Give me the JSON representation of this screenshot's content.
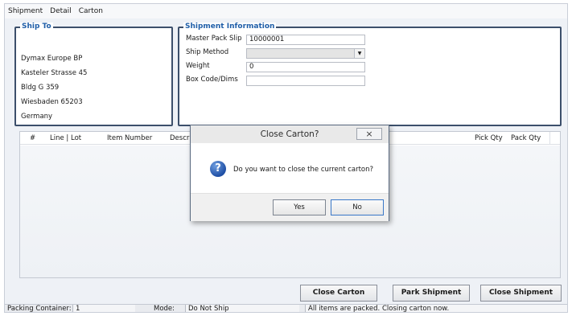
{
  "menu": [
    "Shipment",
    "Detail",
    "Carton"
  ],
  "ship_to": {
    "title": "Ship To",
    "lines": [
      "Dymax Europe BP",
      "Kasteler Strasse 45",
      "Bldg G 359",
      "Wiesbaden  65203",
      "Germany"
    ]
  },
  "shipment_info": {
    "title": "Shipment Information",
    "master_pack_slip_label": "Master Pack Slip",
    "master_pack_slip_value": "10000001",
    "ship_method_label": "Ship Method",
    "ship_method_value": "",
    "weight_label": "Weight",
    "weight_value": "0",
    "box_code_label": "Box Code/Dims",
    "box_code_value": ""
  },
  "grid": {
    "columns": [
      "#",
      "Line | Lot",
      "Item Number",
      "Descri",
      "Pick Qty",
      "Pack Qty"
    ]
  },
  "buttons": {
    "close_carton": "Close Carton",
    "park_shipment": "Park Shipment",
    "close_shipment": "Close Shipment"
  },
  "status": {
    "packing_container_label": "Packing Container:",
    "packing_container_value": "1",
    "mode_label": "Mode:",
    "mode_value": "Do Not Ship",
    "message": "All items are packed.  Closing carton now."
  },
  "dialog": {
    "title": "Close Carton?",
    "close_glyph": "×",
    "icon": "question-icon",
    "icon_glyph": "?",
    "message": "Do you want to close the current carton?",
    "yes_label": "Yes",
    "no_label": "No"
  }
}
